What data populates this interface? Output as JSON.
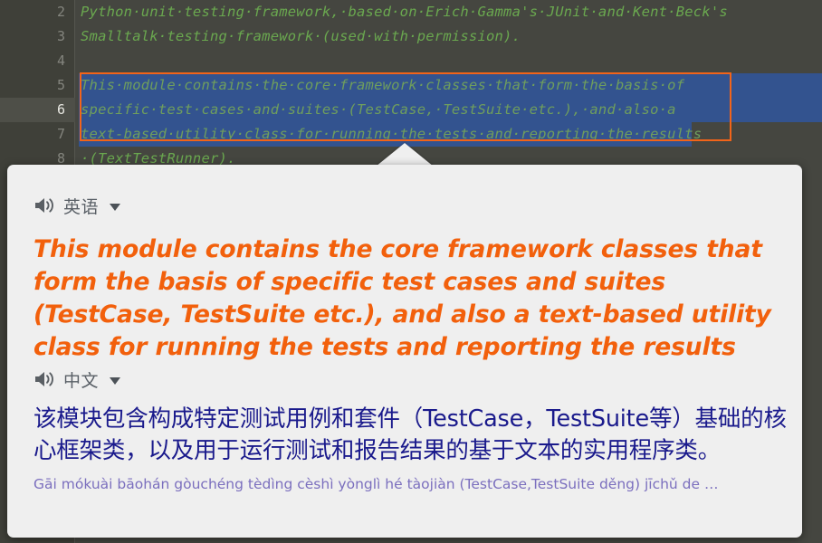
{
  "editor": {
    "language": "python",
    "gutter_bg": "#3F4039",
    "background": "#454640",
    "code_color": "#6AA84F",
    "selection_color": "#33538F",
    "highlight_border_color": "#F26419",
    "current_line": 6,
    "lines": [
      {
        "number": "2",
        "text": "Python·unit·testing·framework,·based·on·Erich·Gamma's·JUnit·and·Kent·Beck's",
        "selected": false
      },
      {
        "number": "3",
        "text": "Smalltalk·testing·framework·(used·with·permission).",
        "selected": false
      },
      {
        "number": "4",
        "text": "",
        "selected": false
      },
      {
        "number": "5",
        "text": "This·module·contains·the·core·framework·classes·that·form·the·basis·of",
        "selected": true
      },
      {
        "number": "6",
        "text": "specific·test·cases·and·suites·(TestCase,·TestSuite·etc.),·and·also·a",
        "selected": true
      },
      {
        "number": "7",
        "text": "text-based·utility·class·for·running·the·tests·and·reporting·the·results",
        "selected": true
      },
      {
        "number": "8",
        "text": "·(TextTestRunner).",
        "selected": false
      }
    ]
  },
  "popup": {
    "background": "#EFEFEF",
    "source": {
      "speaker_icon": "speaker-icon",
      "language_label": "英语",
      "dropdown_icon": "chevron-down-icon",
      "text": "This module contains the core framework classes that form the basis of specific test cases and suites (TestCase, TestSuite etc.), and also a text-based utility class for running the tests and reporting the results",
      "color": "#F2600C"
    },
    "target": {
      "speaker_icon": "speaker-icon",
      "language_label": "中文",
      "dropdown_icon": "chevron-down-icon",
      "text": "该模块包含构成特定测试用例和套件（TestCase，TestSuite等）基础的核心框架类，以及用于运行测试和报告结果的基于文本的实用程序类。",
      "color": "#1A1A8C",
      "pinyin": "Gāi mókuài bāohán gòuchéng tèdìng cèshì yònglì hé tàojiàn (TestCase,TestSuite děng) jīchǔ de …",
      "pinyin_color": "#7B6FBE"
    }
  }
}
